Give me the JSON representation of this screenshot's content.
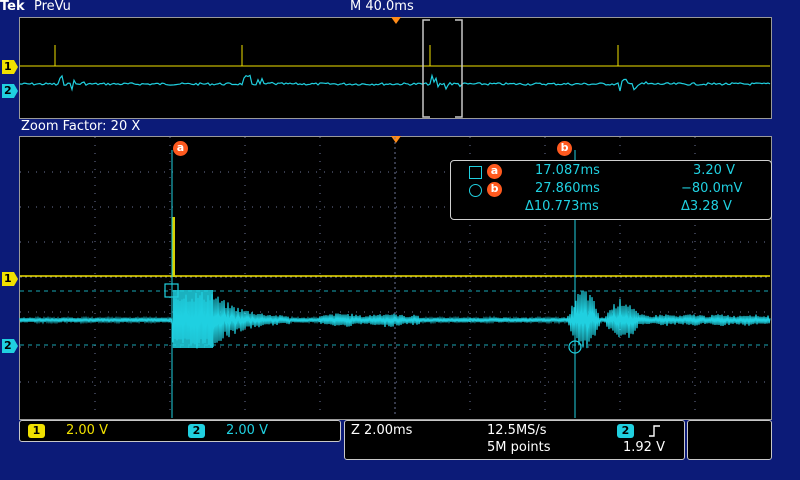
{
  "header": {
    "brand": "Tek",
    "mode": "PreVu",
    "main_timebase": "M 40.0ms"
  },
  "zoom_factor": "Zoom Factor: 20 X",
  "markers": {
    "ch1": "1",
    "ch2": "2"
  },
  "cursors": {
    "a_label": "a",
    "b_label": "b"
  },
  "cursor_readout": {
    "a_time": "17.087ms",
    "a_value": "3.20 V",
    "b_time": "27.860ms",
    "b_value": "−80.0mV",
    "delta_time": "Δ10.773ms",
    "delta_value": "Δ3.28 V"
  },
  "channels": [
    {
      "num": "1",
      "scale": "2.00 V",
      "color": "#f0e000"
    },
    {
      "num": "2",
      "scale": "2.00 V",
      "color": "#20d0e0"
    }
  ],
  "timebase": {
    "zoom": "Z 2.00ms",
    "sample_rate": "12.5MS/s",
    "record_length": "5M points",
    "trigger_source": "2",
    "trigger_slope_icon": "rising-edge-icon",
    "trigger_level": "1.92 V"
  },
  "colors": {
    "background": "#0c1b78",
    "ch1": "#f0e000",
    "ch2": "#20d0e0",
    "cursor_label": "#ff5a1f",
    "grid": "#6b7596"
  }
}
